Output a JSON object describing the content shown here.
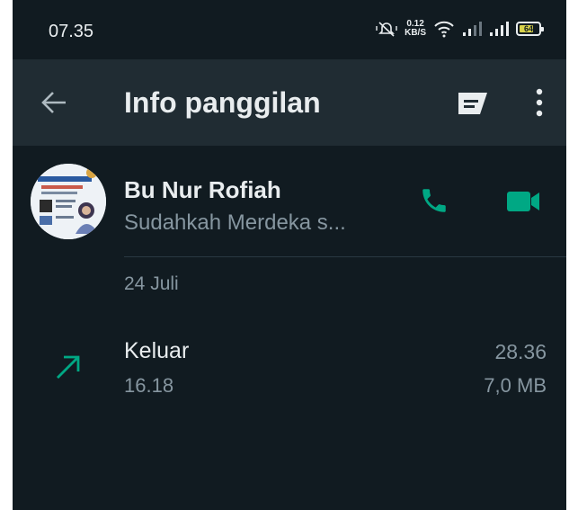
{
  "status_bar": {
    "time": "07.35",
    "net_speed_value": "0.12",
    "net_speed_unit": "KB/S",
    "battery_level": "64",
    "icons": [
      "mute-vibrate-icon",
      "wifi-icon",
      "signal-icon",
      "signal-icon",
      "battery-icon"
    ]
  },
  "app_bar": {
    "title": "Info panggilan",
    "icons": [
      "back-arrow-icon",
      "message-icon",
      "more-vert-icon"
    ]
  },
  "contact": {
    "name": "Bu Nur Rofiah",
    "status": "Sudahkah Merdeka s...",
    "icons": [
      "phone-icon",
      "video-camera-icon"
    ]
  },
  "call_log": {
    "date": "24 Juli",
    "entries": [
      {
        "direction": "Keluar",
        "time": "16.18",
        "duration": "28.36",
        "data_size": "7,0 MB",
        "icon": "outgoing-arrow-icon"
      }
    ]
  },
  "colors": {
    "background": "#111b21",
    "app_bar": "#202c33",
    "accent": "#00a884",
    "primary_text": "#e9edef",
    "secondary_text": "#8696a0"
  }
}
